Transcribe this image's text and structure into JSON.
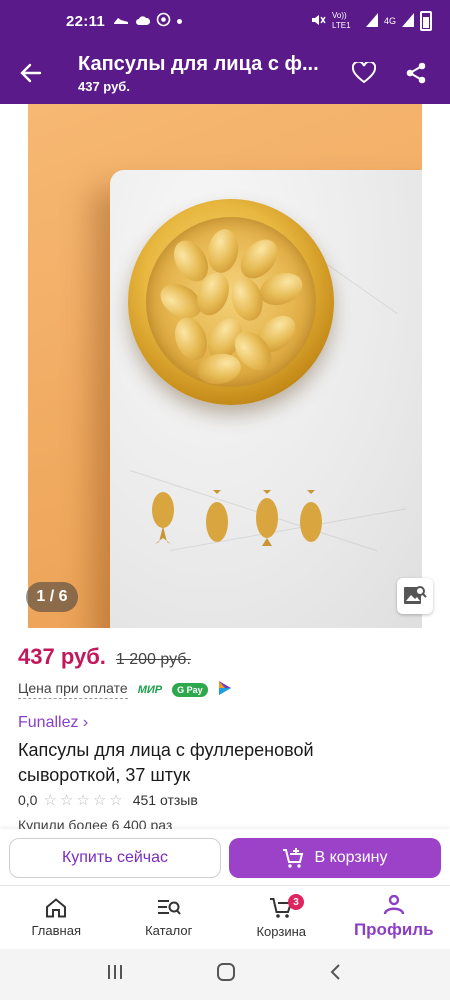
{
  "status_bar": {
    "time": "22:11",
    "network_label": "Vo)) LTE1",
    "network_type": "4G"
  },
  "app_bar": {
    "title": "Капсулы для лица с ф...",
    "subtitle": "437 руб."
  },
  "gallery": {
    "counter": "1 / 6"
  },
  "product": {
    "price": "437 руб.",
    "old_price": "1 200 руб.",
    "pay_label": "Цена при оплате",
    "pay_methods": [
      "МИР",
      "G Pay"
    ],
    "brand": "Funallez ›",
    "name": "Капсулы для лица с фуллереновой сывороткой, 37 штук",
    "rating": "0,0",
    "stars_filled": 0,
    "stars_total": 5,
    "reviews": "451 отзыв",
    "bought": "Купили более 6 400 раз"
  },
  "actions": {
    "buy_now": "Купить сейчас",
    "add_to_cart": "В корзину"
  },
  "bottom_nav": {
    "items": [
      {
        "label": "Главная",
        "icon": "home-icon"
      },
      {
        "label": "Каталог",
        "icon": "catalog-icon"
      },
      {
        "label": "Корзина",
        "icon": "cart-icon",
        "badge": "3"
      },
      {
        "label": "Профиль",
        "icon": "profile-icon",
        "active": true
      }
    ]
  },
  "colors": {
    "brand_purple": "#5a1a8a",
    "accent_purple": "#9b42c9",
    "price_pink": "#c2185b",
    "badge_red": "#e0245e"
  }
}
